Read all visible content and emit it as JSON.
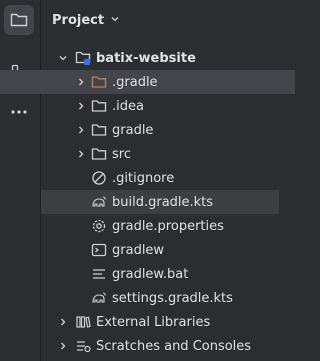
{
  "header": {
    "title": "Project"
  },
  "tree": {
    "root": {
      "label": "batix-website"
    },
    "children": [
      {
        "label": ".gradle",
        "kind": "folder-orange",
        "expandable": true
      },
      {
        "label": ".idea",
        "kind": "folder",
        "expandable": true
      },
      {
        "label": "gradle",
        "kind": "folder",
        "expandable": true
      },
      {
        "label": "src",
        "kind": "folder",
        "expandable": true
      },
      {
        "label": ".gitignore",
        "kind": "ignore",
        "expandable": false
      },
      {
        "label": "build.gradle.kts",
        "kind": "gradle",
        "expandable": false
      },
      {
        "label": "gradle.properties",
        "kind": "gear",
        "expandable": false
      },
      {
        "label": "gradlew",
        "kind": "terminal",
        "expandable": false
      },
      {
        "label": "gradlew.bat",
        "kind": "text",
        "expandable": false
      },
      {
        "label": "settings.gradle.kts",
        "kind": "gradle",
        "expandable": false
      }
    ],
    "external_libraries": {
      "label": "External Libraries"
    },
    "scratches": {
      "label": "Scratches and Consoles"
    }
  },
  "colors": {
    "background": "#2b2d30",
    "selected_row": "#43454a",
    "orange_folder": "#c77d55",
    "text": "#dfe1e5",
    "icon": "#ced0d6"
  }
}
